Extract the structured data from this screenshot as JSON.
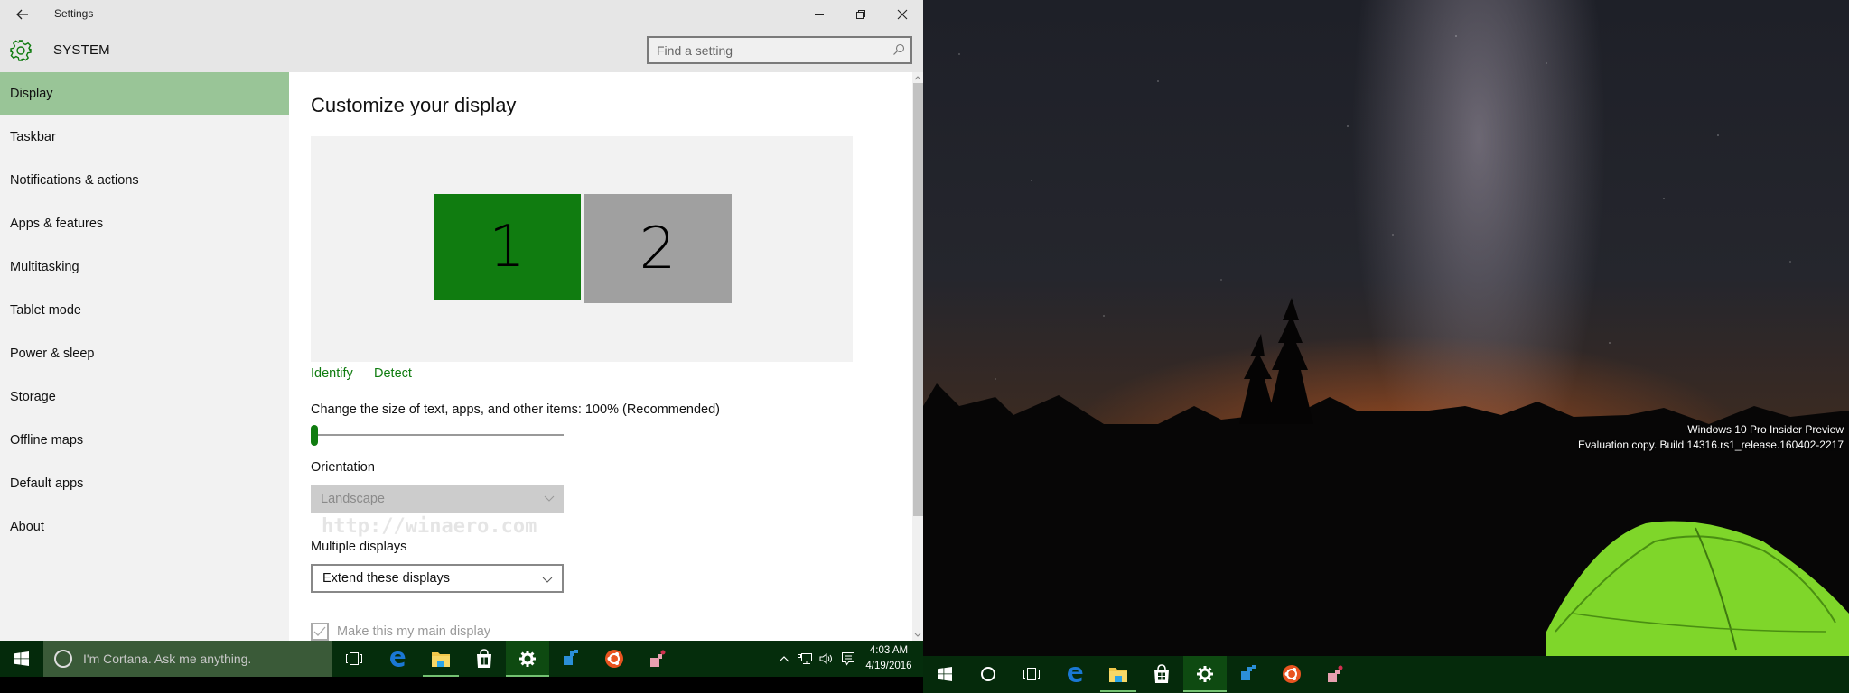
{
  "window": {
    "title": "Settings",
    "back_icon": "back-arrow-icon",
    "controls": {
      "minimize": "minimize-icon",
      "maximize": "restore-icon",
      "close": "close-icon"
    }
  },
  "header": {
    "section_icon": "gear-icon",
    "section_title": "SYSTEM",
    "search": {
      "placeholder": "Find a setting",
      "value": "",
      "icon": "search-icon"
    }
  },
  "sidebar": {
    "items": [
      {
        "label": "Display",
        "active": true
      },
      {
        "label": "Taskbar",
        "active": false
      },
      {
        "label": "Notifications & actions",
        "active": false
      },
      {
        "label": "Apps & features",
        "active": false
      },
      {
        "label": "Multitasking",
        "active": false
      },
      {
        "label": "Tablet mode",
        "active": false
      },
      {
        "label": "Power & sleep",
        "active": false
      },
      {
        "label": "Storage",
        "active": false
      },
      {
        "label": "Offline maps",
        "active": false
      },
      {
        "label": "Default apps",
        "active": false
      },
      {
        "label": "About",
        "active": false
      }
    ]
  },
  "main": {
    "heading": "Customize your display",
    "monitors": [
      {
        "number": "1",
        "selected": true,
        "color": "#107c10"
      },
      {
        "number": "2",
        "selected": false,
        "color": "#a0a0a0"
      }
    ],
    "links": {
      "identify": "Identify",
      "detect": "Detect"
    },
    "scale": {
      "label": "Change the size of text, apps, and other items: 100% (Recommended)",
      "slider_fraction": 0.0
    },
    "orientation": {
      "label": "Orientation",
      "value": "Landscape",
      "disabled": true
    },
    "multiple_displays": {
      "label": "Multiple displays",
      "value": "Extend these displays"
    },
    "main_display_checkbox": {
      "label": "Make this my main display",
      "checked": true,
      "disabled": true
    },
    "watermark": "http://winaero.com"
  },
  "taskbar_left": {
    "start_icon": "windows-logo-icon",
    "cortana_placeholder": "I'm Cortana. Ask me anything.",
    "apps": [
      {
        "name": "task-view-icon",
        "running": false,
        "focused": false
      },
      {
        "name": "edge-icon",
        "running": false,
        "focused": false
      },
      {
        "name": "file-explorer-icon",
        "running": true,
        "focused": false
      },
      {
        "name": "store-icon",
        "running": false,
        "focused": false
      },
      {
        "name": "settings-icon",
        "running": true,
        "focused": true
      },
      {
        "name": "registry-editor-icon",
        "running": false,
        "focused": false
      },
      {
        "name": "ubuntu-icon",
        "running": false,
        "focused": false
      },
      {
        "name": "winaero-tweaker-icon",
        "running": false,
        "focused": false
      }
    ],
    "tray": {
      "icons": [
        "chevron-up-icon",
        "network-icon",
        "volume-icon",
        "action-center-icon"
      ],
      "time": "4:03 AM",
      "date": "4/19/2016"
    }
  },
  "desktop_right": {
    "watermark_line1": "Windows 10 Pro Insider Preview",
    "watermark_line2": "Evaluation copy. Build 14316.rs1_release.160402-2217"
  },
  "taskbar_right": {
    "apps": [
      {
        "name": "windows-logo-icon",
        "running": false,
        "focused": false
      },
      {
        "name": "cortana-circle-icon",
        "running": false,
        "focused": false
      },
      {
        "name": "task-view-icon",
        "running": false,
        "focused": false
      },
      {
        "name": "edge-icon",
        "running": false,
        "focused": false
      },
      {
        "name": "file-explorer-icon",
        "running": true,
        "focused": false
      },
      {
        "name": "store-icon",
        "running": false,
        "focused": false
      },
      {
        "name": "settings-icon",
        "running": true,
        "focused": true
      },
      {
        "name": "registry-editor-icon",
        "running": false,
        "focused": false
      },
      {
        "name": "ubuntu-icon",
        "running": false,
        "focused": false
      },
      {
        "name": "winaero-tweaker-icon",
        "running": false,
        "focused": false
      }
    ]
  },
  "colors": {
    "accent": "#107c10",
    "nav_active": "#99c597",
    "taskbar": "#052d0c",
    "cortana_box": "#3a5a38"
  }
}
